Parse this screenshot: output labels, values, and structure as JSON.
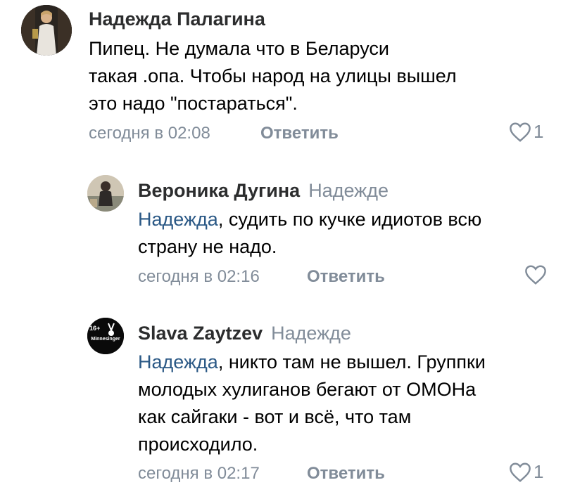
{
  "comments": [
    {
      "author": "Надежда Палагина",
      "reply_to": "",
      "mention": "",
      "text_lines": [
        "Пипец. Не думала что в Беларуси",
        "такая .опа. Чтобы народ на улицы вышел",
        "это надо \"постараться\"."
      ],
      "time": "сегодня в 02:08",
      "reply_label": "Ответить",
      "likes": "1"
    },
    {
      "author": "Вероника Дугина",
      "reply_to": "Надежде",
      "mention": "Надежда",
      "text_lines": [
        ", судить по кучке идиотов всю",
        "страну не надо."
      ],
      "time": "сегодня в 02:16",
      "reply_label": "Ответить",
      "likes": ""
    },
    {
      "author": "Slava Zaytzev",
      "reply_to": "Надежде",
      "mention": "Надежда",
      "text_lines": [
        ", никто там не вышел. Группки",
        "молодых хулиганов бегают от ОМОНа",
        "как сайгаки - вот и всё, что там",
        "происходило."
      ],
      "time": "сегодня в 02:17",
      "reply_label": "Ответить",
      "likes": "1",
      "avatar_badge": "16+",
      "avatar_text": "Minnesinger"
    }
  ],
  "colors": {
    "accent": "#2a5885",
    "secondary": "#818c99",
    "author": "#2c2d2e"
  }
}
